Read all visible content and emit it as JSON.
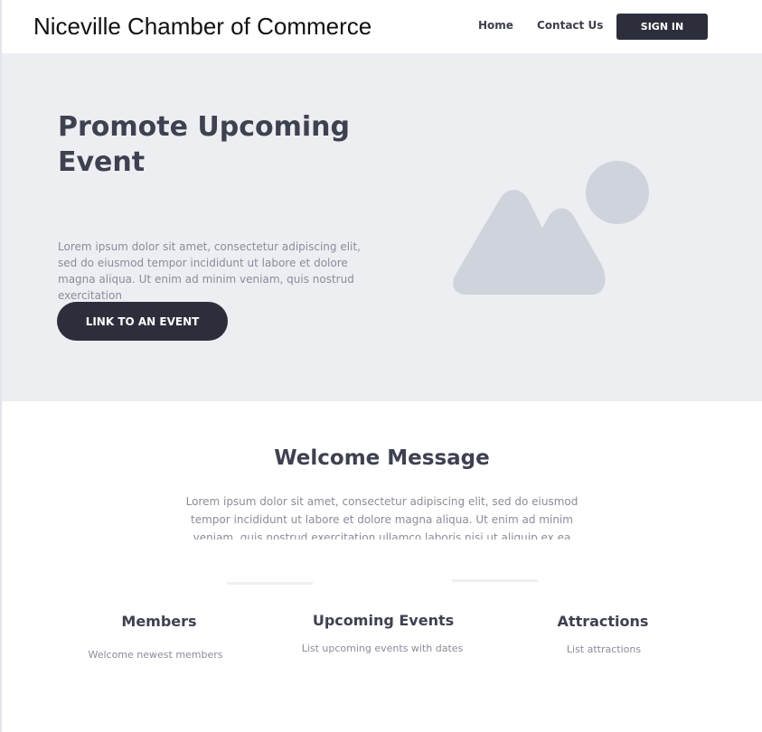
{
  "header": {
    "brand": "Niceville Chamber of Commerce",
    "nav": {
      "home": "Home",
      "contact": "Contact Us"
    },
    "sign_in_label": "SIGN IN"
  },
  "hero": {
    "title": "Promote Upcoming Event",
    "text": "Lorem ipsum dolor sit amet, consectetur adipiscing elit, sed do eiusmod tempor incididunt ut labore et dolore magna aliqua. Ut enim ad minim veniam, quis nostrud exercitation",
    "button_label": "LINK TO AN EVENT",
    "image_icon": "image-placeholder-icon"
  },
  "welcome": {
    "title": "Welcome Message",
    "text": "Lorem ipsum dolor sit amet, consectetur adipiscing elit, sed do eiusmod tempor incididunt ut labore et dolore magna aliqua. Ut enim ad minim veniam, quis nostrud exercitation ullamco laboris nisi ut aliquip ex ea"
  },
  "features": [
    {
      "title": "Members",
      "desc": "Welcome newest members"
    },
    {
      "title": "Upcoming Events",
      "desc": "List upcoming events with dates"
    },
    {
      "title": "Attractions",
      "desc": "List attractions"
    }
  ],
  "colors": {
    "dark": "#2c2f3b",
    "heading": "#3e4150",
    "muted": "#8a8d99",
    "hero_bg": "#edeef2",
    "placeholder": "#cfd3dc"
  }
}
